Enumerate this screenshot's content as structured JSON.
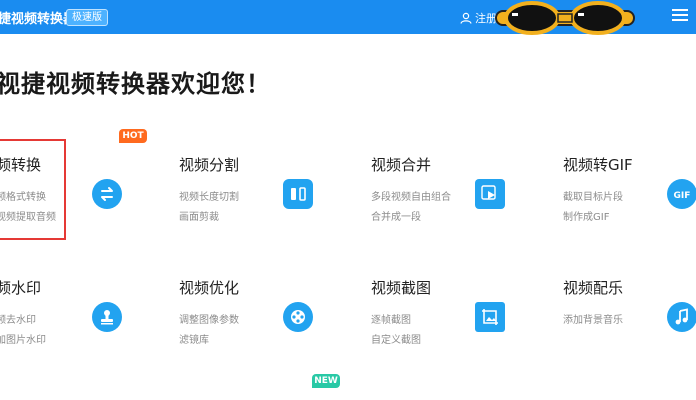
{
  "header": {
    "app_title": "捷视频转换器",
    "speed_badge": "极速版",
    "user_label": "注册",
    "colors": {
      "bar": "#1a8cf0",
      "hot": "#ff6a1f",
      "new": "#29c9a6",
      "icon": "#22a3f0",
      "selected": "#e53935"
    }
  },
  "welcome": "视捷视频转换器欢迎您！",
  "badges": {
    "hot": "HOT",
    "new": "NEW"
  },
  "features": [
    {
      "title": "频转换",
      "sub1": "频格式转换",
      "sub2": "视频提取音频",
      "icon": "swap-arrows-icon"
    },
    {
      "title": "视频分割",
      "sub1": "视频长度切割",
      "sub2": "画面剪裁",
      "icon": "split-icon"
    },
    {
      "title": "视频合并",
      "sub1": "多段视频自由组合",
      "sub2": "合并成一段",
      "icon": "merge-play-icon"
    },
    {
      "title": "视频转GIF",
      "sub1": "截取目标片段",
      "sub2": "制作成GIF",
      "icon": "gif-icon"
    },
    {
      "title": "频水印",
      "sub1": "频去水印",
      "sub2": "加图片水印",
      "icon": "stamp-icon"
    },
    {
      "title": "视频优化",
      "sub1": "调整图像参数",
      "sub2": "滤镜库",
      "icon": "film-reel-icon"
    },
    {
      "title": "视频截图",
      "sub1": "逐帧截图",
      "sub2": "自定义截图",
      "icon": "image-crop-icon"
    },
    {
      "title": "视频配乐",
      "sub1": "添加背景音乐",
      "sub2": "",
      "icon": "music-note-icon"
    }
  ]
}
